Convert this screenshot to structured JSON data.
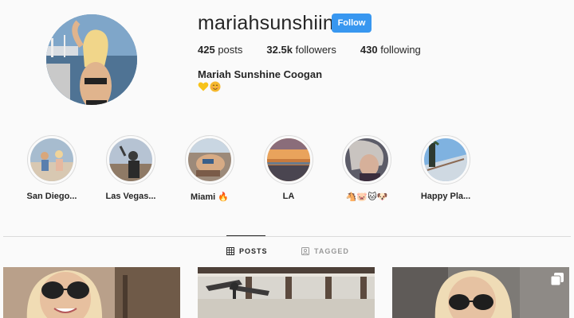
{
  "profile": {
    "username": "mariahsunshiinee",
    "follow_label": "Follow",
    "stats": {
      "posts_count": "425",
      "posts_label": "posts",
      "followers_count": "32.5k",
      "followers_label": "followers",
      "following_count": "430",
      "following_label": "following"
    },
    "full_name": "Mariah Sunshine Coogan",
    "bio_emojis": [
      "yellow-heart",
      "blush-face"
    ]
  },
  "highlights": [
    {
      "label": "San Diego..."
    },
    {
      "label": "Las Vegas..."
    },
    {
      "label": "Miami 🔥"
    },
    {
      "label": "LA"
    },
    {
      "label": "🐴🐷🐱🐶"
    },
    {
      "label": "Happy Pla..."
    }
  ],
  "tabs": {
    "posts_label": "POSTS",
    "tagged_label": "TAGGED"
  },
  "colors": {
    "accent": "#3897f0",
    "text": "#262626",
    "muted": "#999999",
    "border": "#dbdbdb",
    "background": "#fafafa"
  }
}
